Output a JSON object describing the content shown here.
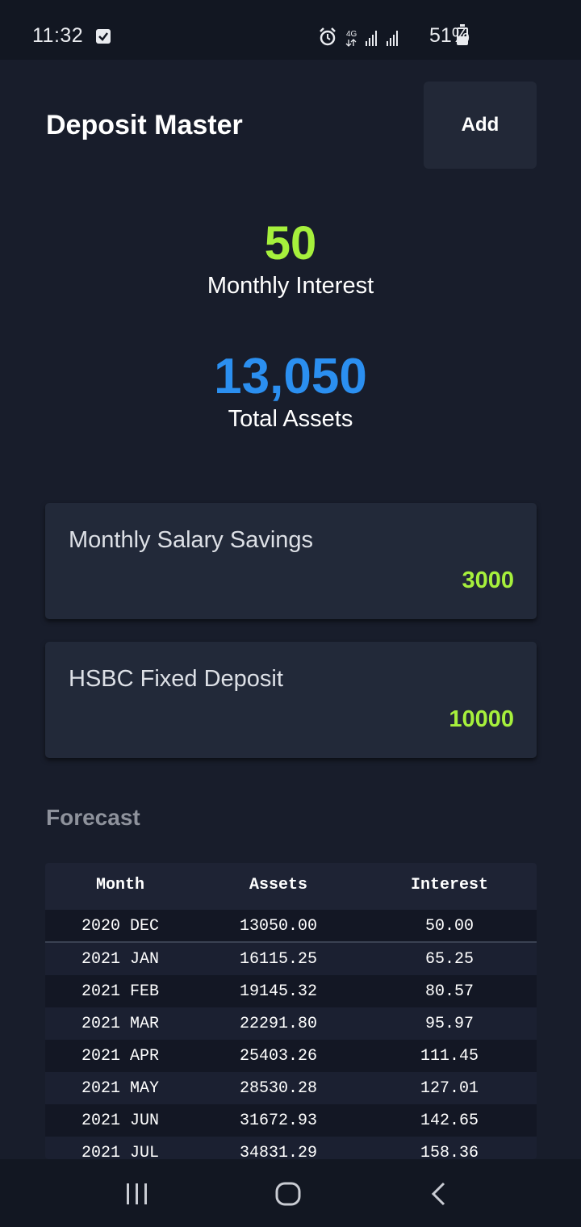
{
  "status": {
    "time": "11:32",
    "battery": "51%",
    "network": "4G"
  },
  "header": {
    "title": "Deposit Master",
    "add_label": "Add"
  },
  "summary": {
    "monthly_interest_value": "50",
    "monthly_interest_label": "Monthly Interest",
    "total_assets_value": "13,050",
    "total_assets_label": "Total Assets"
  },
  "deposits": [
    {
      "name": "Monthly Salary Savings",
      "amount": "3000"
    },
    {
      "name": "HSBC Fixed Deposit",
      "amount": "10000"
    }
  ],
  "forecast": {
    "title": "Forecast",
    "columns": [
      "Month",
      "Assets",
      "Interest"
    ],
    "rows": [
      {
        "month": "2020 DEC",
        "assets": "13050.00",
        "interest": "50.00"
      },
      {
        "month": "2021 JAN",
        "assets": "16115.25",
        "interest": "65.25"
      },
      {
        "month": "2021 FEB",
        "assets": "19145.32",
        "interest": "80.57"
      },
      {
        "month": "2021 MAR",
        "assets": "22291.80",
        "interest": "95.97"
      },
      {
        "month": "2021 APR",
        "assets": "25403.26",
        "interest": "111.45"
      },
      {
        "month": "2021 MAY",
        "assets": "28530.28",
        "interest": "127.01"
      },
      {
        "month": "2021 JUN",
        "assets": "31672.93",
        "interest": "142.65"
      },
      {
        "month": "2021 JUL",
        "assets": "34831.29",
        "interest": "158.36"
      }
    ]
  },
  "colors": {
    "background": "#181d2b",
    "interest_green": "#a6f03c",
    "assets_blue": "#2b8ff0",
    "card": "#222939"
  },
  "nav": {
    "icons": [
      "recent-apps-icon",
      "home-icon",
      "back-icon"
    ]
  }
}
